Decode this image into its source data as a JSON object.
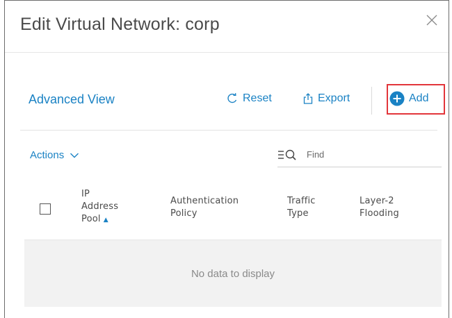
{
  "dialog": {
    "title": "Edit Virtual Network: corp"
  },
  "toolbar": {
    "advanced_view": "Advanced View",
    "reset_label": "Reset",
    "export_label": "Export",
    "add_label": "Add"
  },
  "filters": {
    "actions_label": "Actions",
    "find_placeholder": "Find"
  },
  "table": {
    "columns": [
      {
        "label": "IP Address Pool",
        "lines": [
          "IP",
          "Address",
          "Pool"
        ],
        "sorted": "ascending"
      },
      {
        "label": "Authentication Policy",
        "lines": [
          "Authentication",
          "Policy"
        ]
      },
      {
        "label": "Traffic Type",
        "lines": [
          "Traffic",
          "Type"
        ]
      },
      {
        "label": "Layer-2 Flooding",
        "lines": [
          "Layer-2",
          "Flooding"
        ]
      }
    ],
    "empty_message": "No data to display"
  },
  "colors": {
    "accent": "#1a82c4",
    "highlight_box": "#e2353a"
  }
}
